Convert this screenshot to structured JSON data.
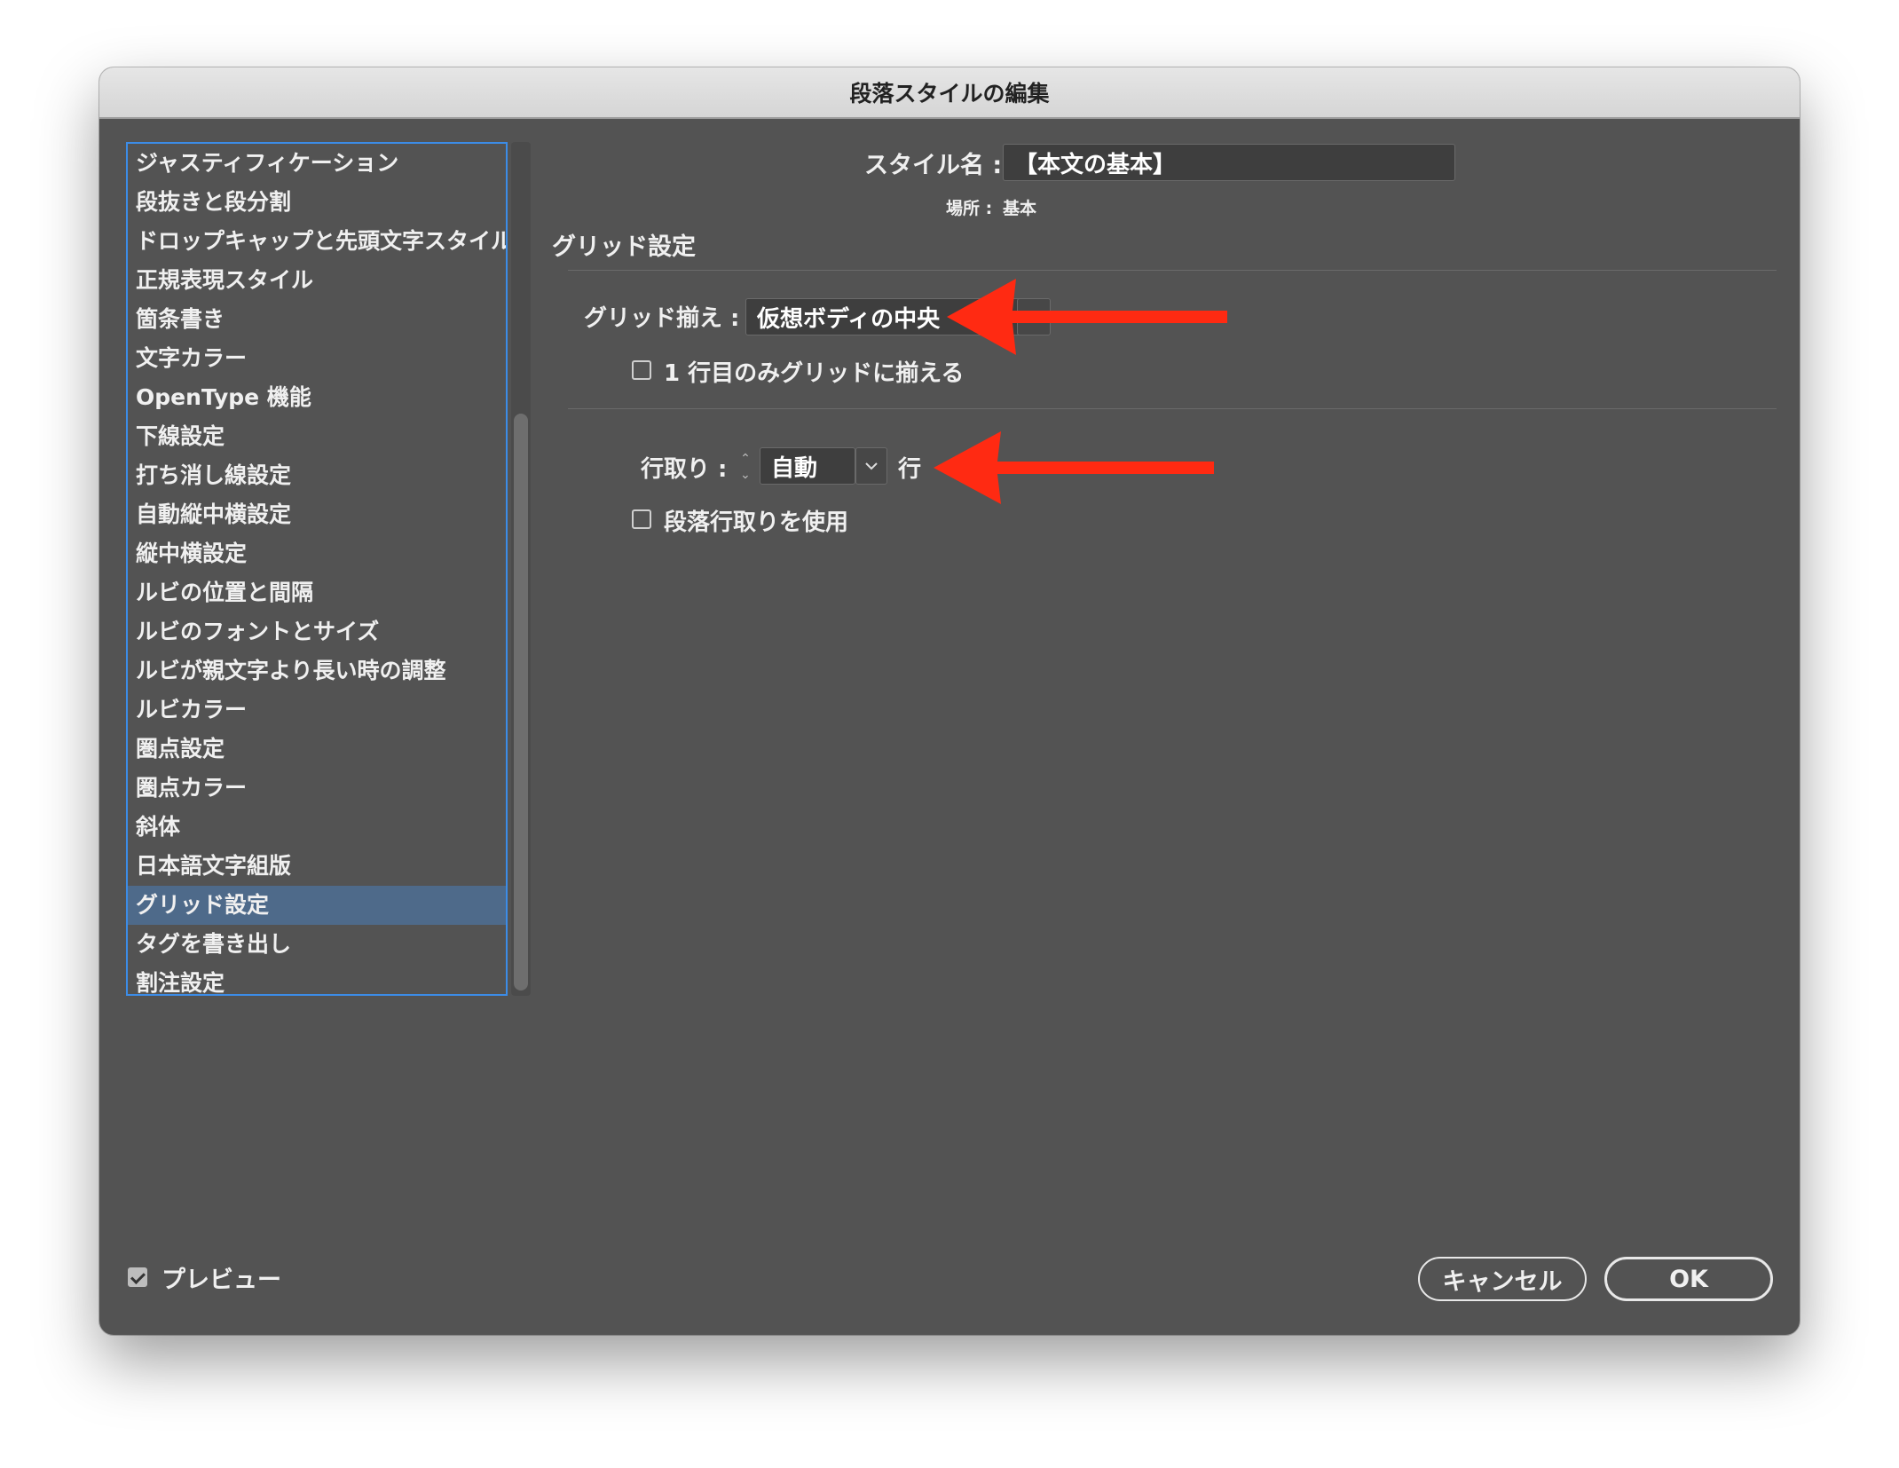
{
  "dialog": {
    "title": "段落スタイルの編集"
  },
  "categories": [
    {
      "label": "ジャスティフィケーション",
      "selected": false
    },
    {
      "label": "段抜きと段分割",
      "selected": false
    },
    {
      "label": "ドロップキャップと先頭文字スタイル",
      "selected": false
    },
    {
      "label": "正規表現スタイル",
      "selected": false
    },
    {
      "label": "箇条書き",
      "selected": false
    },
    {
      "label": "文字カラー",
      "selected": false
    },
    {
      "label": "OpenType 機能",
      "selected": false
    },
    {
      "label": "下線設定",
      "selected": false
    },
    {
      "label": "打ち消し線設定",
      "selected": false
    },
    {
      "label": "自動縦中横設定",
      "selected": false
    },
    {
      "label": "縦中横設定",
      "selected": false
    },
    {
      "label": "ルビの位置と間隔",
      "selected": false
    },
    {
      "label": "ルビのフォントとサイズ",
      "selected": false
    },
    {
      "label": "ルビが親文字より長い時の調整",
      "selected": false
    },
    {
      "label": "ルビカラー",
      "selected": false
    },
    {
      "label": "圏点設定",
      "selected": false
    },
    {
      "label": "圏点カラー",
      "selected": false
    },
    {
      "label": "斜体",
      "selected": false
    },
    {
      "label": "日本語文字組版",
      "selected": false
    },
    {
      "label": "グリッド設定",
      "selected": true
    },
    {
      "label": "タグを書き出し",
      "selected": false
    },
    {
      "label": "割注設定",
      "selected": false
    }
  ],
  "style": {
    "name_label": "スタイル名 :",
    "name_value": "【本文の基本】",
    "location_label": "場所 :",
    "location_value": "基本"
  },
  "section": {
    "title": "グリッド設定"
  },
  "grid": {
    "align_label": "グリッド揃え :",
    "align_value": "仮想ボディの中央",
    "first_line_only_label": "1 行目のみグリッドに揃える",
    "first_line_only_checked": false
  },
  "line_span": {
    "label": "行取り :",
    "value": "自動",
    "unit": "行",
    "paragraph_span_label": "段落行取りを使用",
    "paragraph_span_checked": false
  },
  "footer": {
    "preview_label": "プレビュー",
    "preview_checked": true,
    "cancel_label": "キャンセル",
    "ok_label": "OK"
  },
  "colors": {
    "dialog_bg": "#535353",
    "selection": "#4e6a8a",
    "focus_ring": "#3c8ce7",
    "annotation_arrow": "#ff2a12"
  },
  "icons": {
    "stepper": "up-down-stepper-icon",
    "dropdown": "chevron-down-icon",
    "annotation": "red-arrow-icon"
  }
}
